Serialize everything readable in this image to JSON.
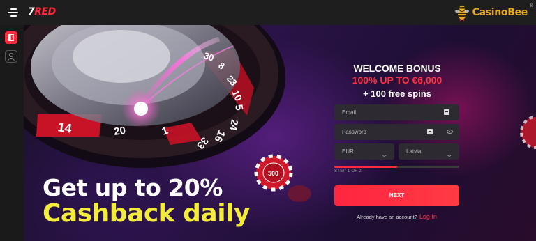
{
  "header": {
    "logo_number": "7",
    "logo_word": "RED",
    "partner_brand": "CasinoBee",
    "partner_reg_mark": "®"
  },
  "sidebar": {
    "items": [
      {
        "name": "casino",
        "icon": "casino-icon",
        "active": true
      },
      {
        "name": "account",
        "icon": "user-icon",
        "active": false
      }
    ]
  },
  "hero": {
    "roulette_numbers": [
      "30",
      "8",
      "23",
      "10",
      "5",
      "24",
      "16",
      "33",
      "1",
      "20",
      "14"
    ],
    "chip_label": "500",
    "promo_line1": "Get up to 20%",
    "promo_line2": "Cashback daily"
  },
  "form": {
    "welcome": "WELCOME BONUS",
    "bonus": "100% UP TO €6,000",
    "spins": "+ 100 free spins",
    "email_placeholder": "Email",
    "password_placeholder": "Password",
    "currency": "EUR",
    "country": "Latvia",
    "step_text": "STEP 1 OF 2",
    "progress_fraction": 0.5,
    "next_label": "NEXT",
    "already_text": "Already have an account?",
    "login_label": "Log In"
  },
  "colors": {
    "accent_red": "#ff2a3c",
    "promo_yellow": "#f3ec3a",
    "partner_gold": "#e6a91f"
  }
}
